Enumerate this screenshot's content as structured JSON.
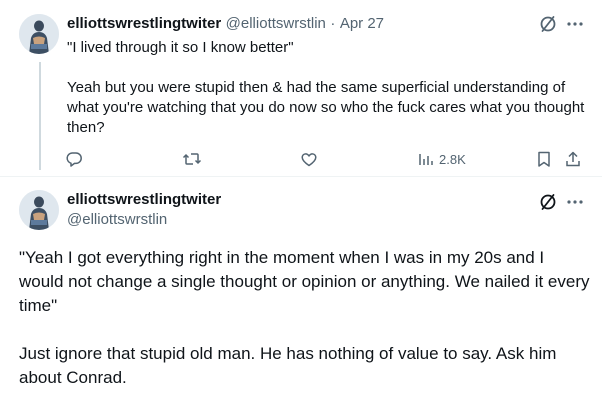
{
  "tweet1": {
    "author_name": "elliottswrestlingtwiter",
    "author_handle": "@elliottswrstlin",
    "separator": "·",
    "date": "Apr 27",
    "text": "\"I lived through it so I know better\"\n\nYeah but you were stupid then & had the same superficial understanding of what you're watching that you do now so who the fuck cares what you thought then?",
    "views": "2.8K",
    "more_icon": "more-dots-icon",
    "grok_icon": "slash-circle-icon"
  },
  "tweet2": {
    "author_name": "elliottswrestlingtwiter",
    "author_handle": "@elliottswrstlin",
    "text": "\"Yeah I got everything right in the moment when I was in my 20s and I would not change a single thought or opinion or anything. We nailed it every time\"\n\nJust ignore that stupid old man. He has nothing of value to say. Ask him about Conrad."
  },
  "colors": {
    "text": "#0f1419",
    "secondary": "#536471",
    "thread_line": "#cfd9de"
  }
}
